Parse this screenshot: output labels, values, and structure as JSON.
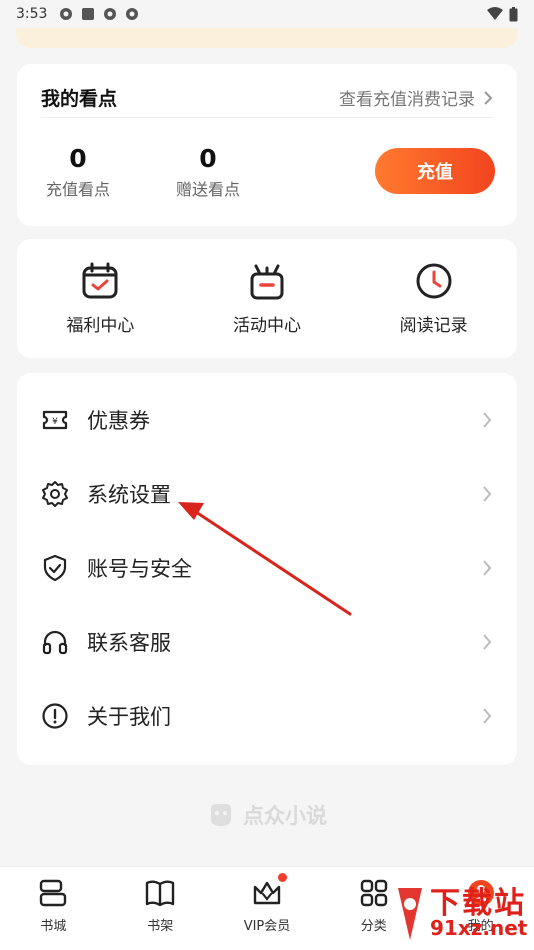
{
  "status_bar": {
    "time": "3:53"
  },
  "points_card": {
    "title": "我的看点",
    "history_link": "查看充值消费记录",
    "recharge": {
      "value": "0",
      "label": "充值看点"
    },
    "gift": {
      "value": "0",
      "label": "赠送看点"
    },
    "recharge_button": "充值"
  },
  "quick_actions": [
    {
      "label": "福利中心",
      "icon": "calendar-check-icon"
    },
    {
      "label": "活动中心",
      "icon": "gift-icon"
    },
    {
      "label": "阅读记录",
      "icon": "clock-icon"
    }
  ],
  "menu": [
    {
      "label": "优惠券",
      "icon": "coupon-icon"
    },
    {
      "label": "系统设置",
      "icon": "gear-icon"
    },
    {
      "label": "账号与安全",
      "icon": "shield-icon"
    },
    {
      "label": "联系客服",
      "icon": "headset-icon"
    },
    {
      "label": "关于我们",
      "icon": "info-icon"
    }
  ],
  "brand": "点众小说",
  "bottom_nav": [
    {
      "label": "书城",
      "icon": "bookstore-icon"
    },
    {
      "label": "书架",
      "icon": "book-icon"
    },
    {
      "label": "VIP会员",
      "icon": "vip-crown-icon"
    },
    {
      "label": "分类",
      "icon": "grid-icon"
    },
    {
      "label": "我的",
      "icon": "profile-icon"
    }
  ],
  "watermark": {
    "title": "下载站",
    "url": "91xz.net"
  },
  "colors": {
    "accent": "#f2441f",
    "arrow": "#d8241c",
    "icon_red": "#e8453c"
  }
}
